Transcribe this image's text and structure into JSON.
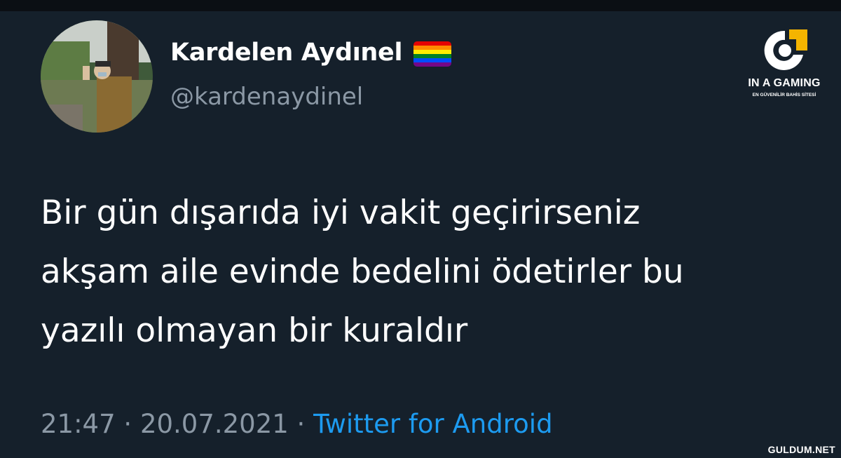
{
  "tweet": {
    "display_name": "Kardelen Aydınel",
    "name_emoji": "rainbow-flag-icon",
    "handle": "@kardenaydinel",
    "text_lines": [
      "Bir gün dışarıda iyi vakit geçirirseniz",
      "akşam aile evinde bedelini ödetirler bu",
      "yazılı olmayan bir kuraldır"
    ],
    "time": "21:47",
    "separator": " · ",
    "date": "20.07.2021",
    "source": "Twitter for Android"
  },
  "brand": {
    "title": "IN A GAMING",
    "subtitle": "EN GÜVENİLİR BAHİS SİTESİ",
    "logo_icon": "g-logo-icon"
  },
  "watermark": "GULDUM.NET",
  "colors": {
    "background": "#15202b",
    "primary_text": "#ffffff",
    "secondary_text": "#8b98a5",
    "link": "#1d9bf0",
    "brand_accent": "#f4b400"
  }
}
